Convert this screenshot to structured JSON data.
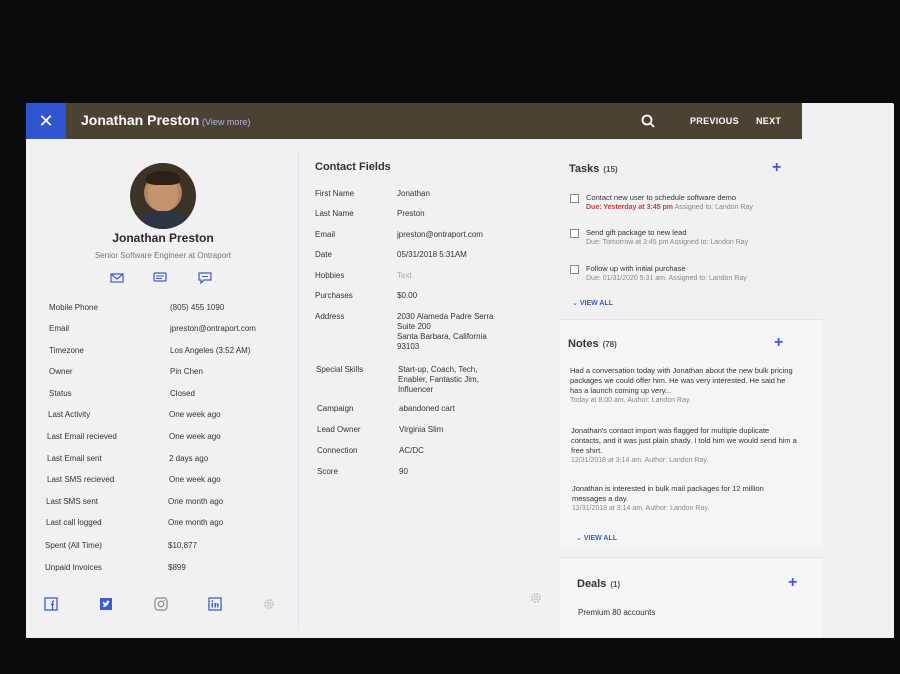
{
  "header": {
    "close_label": "✕",
    "contact_name": "Jonathan Preston",
    "view_more": "(View more)",
    "previous": "PREVIOUS",
    "next": "NEXT"
  },
  "profile": {
    "name": "Jonathan Preston",
    "title": "Senior Software Engineer at Ontraport",
    "fields": [
      {
        "label": "Mobile Phone",
        "value": "(805) 455 1090"
      },
      {
        "label": "Email",
        "value": "jpreston@ontraport.com"
      },
      {
        "label": "Timezone",
        "value": "Los Angeles (3:52 AM)"
      },
      {
        "label": "Owner",
        "value": "Pin Chen"
      },
      {
        "label": "Status",
        "value": "Closed"
      },
      {
        "label": "Last Activity",
        "value": "One week ago"
      },
      {
        "label": "Last Email recieved",
        "value": "One week ago"
      },
      {
        "label": "Last Email sent",
        "value": "2 days ago"
      },
      {
        "label": "Last SMS recieved",
        "value": "One week ago"
      },
      {
        "label": "Last SMS sent",
        "value": "One month ago"
      },
      {
        "label": "Last call logged",
        "value": "One month ago"
      },
      {
        "label": "Spent (All Time)",
        "value": "$10,877"
      },
      {
        "label": "Unpaid Invoices",
        "value": "$899"
      }
    ]
  },
  "contact_fields": {
    "title": "Contact Fields",
    "fields": [
      {
        "label": "First Name",
        "value": "Jonathan"
      },
      {
        "label": "Last Name",
        "value": "Preston"
      },
      {
        "label": "Email",
        "value": "jpreston@ontraport.com"
      },
      {
        "label": "Date",
        "value": "05/31/2018 5:31AM"
      },
      {
        "label": "Hobbies",
        "value": "Text"
      },
      {
        "label": "Purchases",
        "value": "$0.00"
      },
      {
        "label": "Address",
        "value": "2030 Alameda Padre Serra\nSuite 200\nSanta Barbara, California\n93103"
      },
      {
        "label": "Special Skills",
        "value": "Start-up, Coach, Tech,\nEnabler, Fantastic Jim,\nInfluencer"
      },
      {
        "label": "Campaign",
        "value": "abandoned cart"
      },
      {
        "label": "Lead Owner",
        "value": "Virginia Slim"
      },
      {
        "label": "Connection",
        "value": "AC/DC"
      },
      {
        "label": "Score",
        "value": "90"
      }
    ]
  },
  "tasks": {
    "title": "Tasks",
    "count": "(15)",
    "items": [
      {
        "title": "Contact new user to schedule software demo",
        "due": "Due: Yesterday at 3:45 pm",
        "assigned": "Assigned to: Landon Ray"
      },
      {
        "title": "Send gift package to new lead",
        "due": "Due: Tomorrow at 3:45 pm",
        "assigned": "Assigned to: Landon Ray"
      },
      {
        "title": "Follow up with initial purchase",
        "due": "Due: 01/31/2020 5:31 am.",
        "assigned": "Assigned to: Landon Ray"
      }
    ],
    "view_all": "VIEW ALL"
  },
  "notes": {
    "title": "Notes",
    "count": "(78)",
    "items": [
      {
        "text": "Had a conversation today with Jonathan about the new bulk pricing packages we could offer him. He was very interested. He  said he has a launch coming up very...",
        "meta": "Today at 8:00 am. Author: Landon Ray."
      },
      {
        "text": "Jonathan's contact import was flagged for multiple duplicate contacts, and it was just plain shady. I told him we would send him a free shirt.",
        "meta": "12/31/2018 at 3:14 am. Author: Landon Ray."
      },
      {
        "text": "Jonathan is interested in bulk mail packages for 12 million messages a day.",
        "meta": "12/31/2018 at 3:14 am. Author: Landon Ray."
      }
    ],
    "view_all": "VIEW ALL"
  },
  "deals": {
    "title": "Deals",
    "count": "(1)",
    "items": [
      {
        "name": "Premium 80 accounts"
      }
    ]
  },
  "plus_label": "+",
  "colors": {
    "topbar": "#4a4334",
    "accent": "#2f55cf",
    "link": "#3c5bd6",
    "due_red": "#cc3c3c"
  }
}
